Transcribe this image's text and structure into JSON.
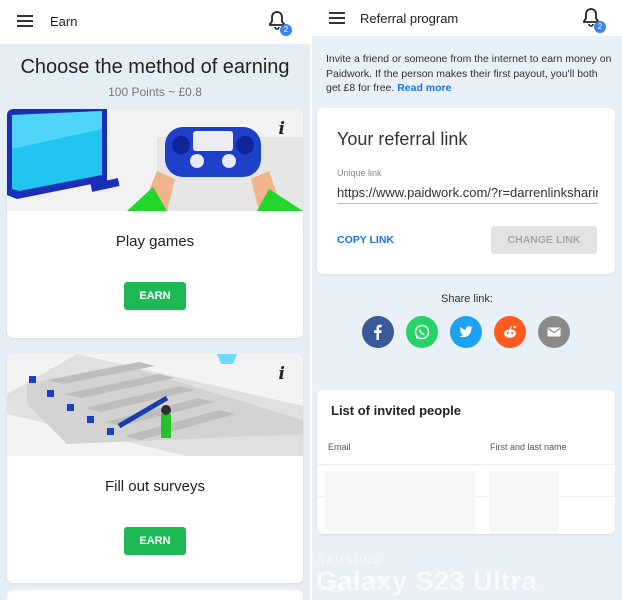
{
  "left_screen": {
    "header": {
      "title": "Earn",
      "notification_count": "2"
    },
    "heading": "Choose the method of earning",
    "subheading": "100 Points ~ £0.8",
    "cards": [
      {
        "label": "Play games",
        "button": "EARN",
        "info": "i"
      },
      {
        "label": "Fill out surveys",
        "button": "EARN",
        "info": "i"
      }
    ]
  },
  "right_screen": {
    "header": {
      "title": "Referral program",
      "notification_count": "2"
    },
    "invite_text": "Invite a friend or someone from the internet to earn money on Paidwork. If the person makes their first payout, you'll both get £8 for free.",
    "read_more": "Read more",
    "referral": {
      "title": "Your referral link",
      "unique_label": "Unique link",
      "link_value": "https://www.paidwork.com/?r=darrenlinksharing",
      "copy_button": "COPY LINK",
      "change_button": "CHANGE LINK"
    },
    "share": {
      "label": "Share link:",
      "icons": [
        "facebook-icon",
        "whatsapp-icon",
        "twitter-icon",
        "reddit-icon",
        "email-icon"
      ],
      "colors": [
        "#3b5998",
        "#25d366",
        "#1da1f2",
        "#ff4500",
        "#888888"
      ]
    },
    "invited": {
      "title": "List of invited people",
      "columns": [
        "Email",
        "First and last name"
      ]
    }
  },
  "watermark": {
    "brand": "SAMSUNG",
    "model": "Galaxy S23 Ultra"
  },
  "colors": {
    "accent_green": "#1db954",
    "link_blue": "#1a73e8",
    "badge_blue": "#3b82f6"
  }
}
